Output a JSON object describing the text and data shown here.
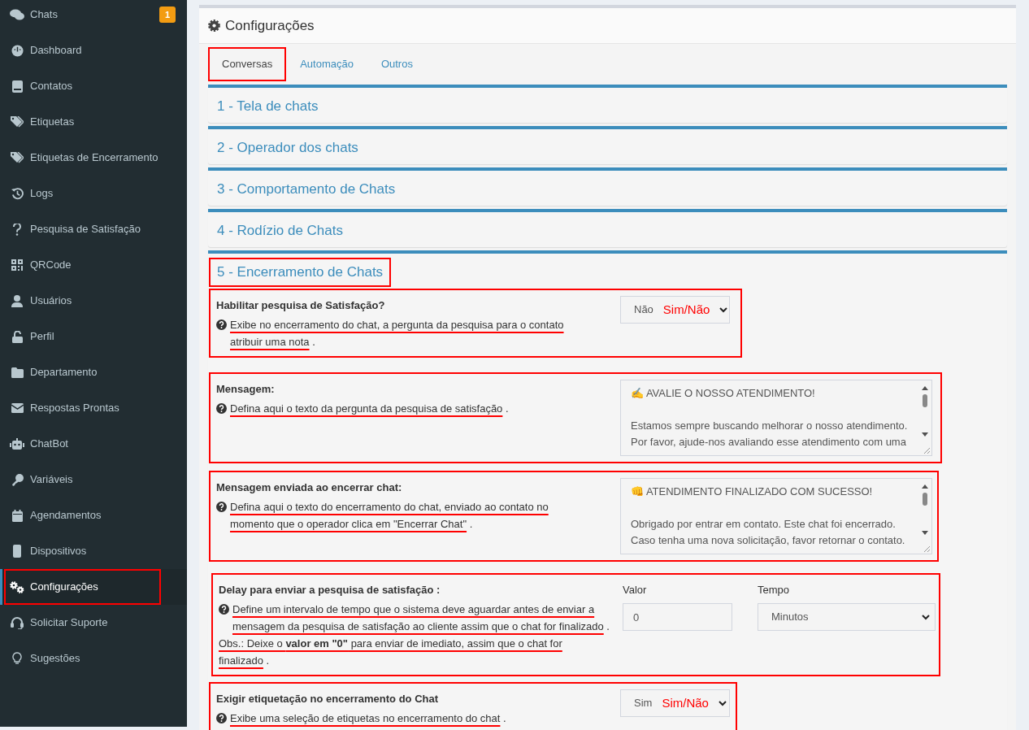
{
  "sidebar": {
    "items": [
      {
        "label": "Chats",
        "badge": "1",
        "selected": false,
        "annotated": false
      },
      {
        "label": "Dashboard",
        "selected": false,
        "annotated": false
      },
      {
        "label": "Contatos",
        "selected": false,
        "annotated": false
      },
      {
        "label": "Etiquetas",
        "selected": false,
        "annotated": false
      },
      {
        "label": "Etiquetas de Encerramento",
        "selected": false,
        "annotated": false
      },
      {
        "label": "Logs",
        "selected": false,
        "annotated": false
      },
      {
        "label": "Pesquisa de Satisfação",
        "selected": false,
        "annotated": false
      },
      {
        "label": "QRCode",
        "selected": false,
        "annotated": false
      },
      {
        "label": "Usuários",
        "selected": false,
        "annotated": false
      },
      {
        "label": "Perfil",
        "selected": false,
        "annotated": false
      },
      {
        "label": "Departamento",
        "selected": false,
        "annotated": false
      },
      {
        "label": "Respostas Prontas",
        "selected": false,
        "annotated": false
      },
      {
        "label": "ChatBot",
        "selected": false,
        "annotated": false
      },
      {
        "label": "Variáveis",
        "selected": false,
        "annotated": false
      },
      {
        "label": "Agendamentos",
        "selected": false,
        "annotated": false
      },
      {
        "label": "Dispositivos",
        "selected": false,
        "annotated": false
      },
      {
        "label": "Configurações",
        "selected": true,
        "annotated": true
      },
      {
        "label": "Solicitar Suporte",
        "selected": false,
        "annotated": false
      },
      {
        "label": "Sugestões",
        "selected": false,
        "annotated": false
      }
    ]
  },
  "card": {
    "title": "Configurações",
    "tabs": [
      {
        "label": "Conversas",
        "selected": true,
        "annotated": true
      },
      {
        "label": "Automação",
        "selected": false,
        "annotated": false
      },
      {
        "label": "Outros",
        "selected": false,
        "annotated": false
      }
    ],
    "sections": [
      {
        "title": "1 - Tela de chats",
        "expanded": false,
        "annotated": false
      },
      {
        "title": "2 - Operador dos chats",
        "expanded": false,
        "annotated": false
      },
      {
        "title": "3 - Comportamento de Chats",
        "expanded": false,
        "annotated": false
      },
      {
        "title": "4 - Rodízio de Chats",
        "expanded": false,
        "annotated": false
      },
      {
        "title": "5 - Encerramento de Chats",
        "expanded": true,
        "annotated": true,
        "rows": [
          {
            "kind": "select",
            "label": "Habilitar pesquisa de Satisfação?",
            "help": [
              {
                "text": "Exibe no encerramento do chat, a pergunta da pesquisa para o contato atribuir uma nota",
                "tail": "."
              }
            ],
            "value": "Não",
            "note": "Sim/Não"
          },
          {
            "kind": "textarea",
            "label": "Mensagem:",
            "help": [
              {
                "text": "Defina aqui o texto da pergunta da pesquisa de satisfação",
                "tail": "."
              }
            ],
            "paragraphs": [
              [
                "✍️ AVALIE O NOSSO ATENDIMENTO!"
              ],
              [
                "Estamos sempre buscando melhorar o nosso atendimento.",
                "Por favor, ajude-nos avaliando esse atendimento com uma"
              ]
            ]
          },
          {
            "kind": "textarea",
            "label": "Mensagem enviada ao encerrar chat:",
            "help": [
              {
                "text": "Defina aqui o texto do encerramento do chat, enviado ao contato no momento que o operador clica em \"Encerrar Chat\"",
                "tail": "."
              }
            ],
            "paragraphs": [
              [
                "👊 ATENDIMENTO FINALIZADO COM SUCESSO!"
              ],
              [
                "Obrigado por entrar em contato. Este chat foi encerrado.",
                "Caso tenha uma nova solicitação, favor retornar o contato."
              ]
            ]
          },
          {
            "kind": "delay",
            "label": "Delay para enviar a pesquisa de satisfação :",
            "help": [
              {
                "text": "Define um intervalo de tempo que o sistema deve aguardar antes de enviar a mensagem da pesquisa de satisfação ao cliente assim que o chat for finalizado",
                "tail": "."
              },
              {
                "text": "Obs.: Deixe o **valor em \"0\"** para enviar de imediato, assim que o chat for finalizado",
                "tail": "."
              }
            ],
            "value_label": "Valor",
            "value": "0",
            "unit_label": "Tempo",
            "unit": "Minutos"
          },
          {
            "kind": "select",
            "label": "Exigir etiquetação no encerramento do Chat",
            "help": [
              {
                "text": "Exibe uma seleção de etiquetas no encerramento do chat",
                "tail": "."
              }
            ],
            "value": "Sim",
            "note": "Sim/Não"
          }
        ]
      }
    ]
  }
}
